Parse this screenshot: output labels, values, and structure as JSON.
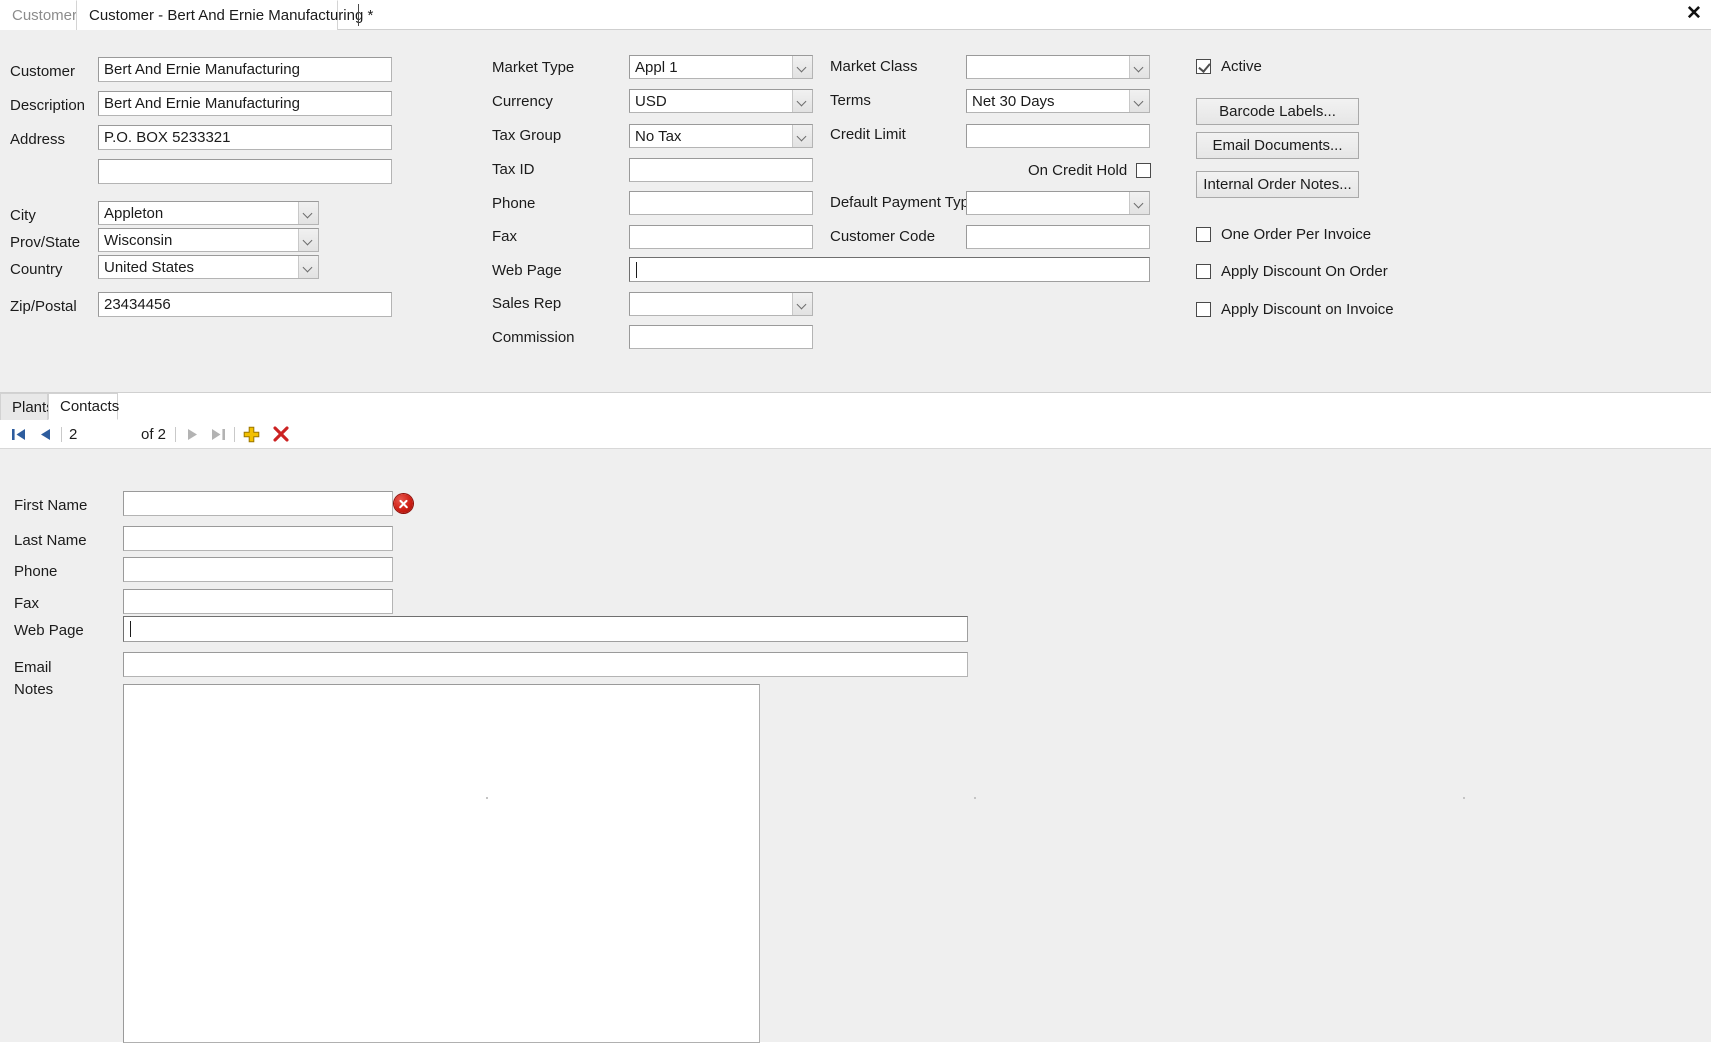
{
  "window": {
    "close_icon": "close-icon"
  },
  "tabs": [
    {
      "label": "Customers",
      "active": false
    },
    {
      "label": "Customer - Bert And Ernie Manufacturing *",
      "active": true
    }
  ],
  "customer_form": {
    "left_column": {
      "fields": [
        {
          "label": "Customer",
          "value": "Bert And Ernie Manufacturing",
          "type": "text"
        },
        {
          "label": "Description",
          "value": "Bert And Ernie Manufacturing",
          "type": "text"
        },
        {
          "label": "Address",
          "value": "P.O. BOX 5233321",
          "type": "text"
        },
        {
          "label": "",
          "value": "",
          "type": "text"
        },
        {
          "label": "City",
          "value": "Appleton",
          "type": "combo"
        },
        {
          "label": "Prov/State",
          "value": "Wisconsin",
          "type": "combo"
        },
        {
          "label": "Country",
          "value": "United States",
          "type": "combo"
        },
        {
          "label": "Zip/Postal",
          "value": "23434456",
          "type": "text"
        }
      ]
    },
    "middle_column": {
      "fields": [
        {
          "label": "Market Type",
          "value": "Appl 1",
          "type": "combo"
        },
        {
          "label": "Currency",
          "value": "USD",
          "type": "combo"
        },
        {
          "label": "Tax Group",
          "value": "No Tax",
          "type": "combo"
        },
        {
          "label": "Tax ID",
          "value": "",
          "type": "text"
        },
        {
          "label": "Phone",
          "value": "",
          "type": "text"
        },
        {
          "label": "Fax",
          "value": "",
          "type": "text"
        },
        {
          "label": "Web Page",
          "value": "",
          "type": "text-focus"
        },
        {
          "label": "Sales Rep",
          "value": "",
          "type": "combo"
        },
        {
          "label": "Commission",
          "value": "",
          "type": "text"
        }
      ]
    },
    "right_column": {
      "fields": [
        {
          "label": "Market Class",
          "value": "",
          "type": "combo"
        },
        {
          "label": "Terms",
          "value": "Net 30 Days",
          "type": "combo"
        },
        {
          "label": "Credit Limit",
          "value": "",
          "type": "text"
        },
        {
          "label": "Default Payment Type",
          "value": "",
          "type": "combo"
        },
        {
          "label": "Customer Code",
          "value": "",
          "type": "text"
        }
      ],
      "on_credit_hold": {
        "label": "On Credit Hold",
        "checked": false
      }
    },
    "actions_panel": {
      "active_checkbox": {
        "label": "Active",
        "checked": true
      },
      "buttons": [
        {
          "label": "Barcode Labels..."
        },
        {
          "label": "Email Documents..."
        },
        {
          "label": "Internal Order Notes..."
        }
      ],
      "checkboxes": [
        {
          "label": "One Order Per Invoice",
          "checked": false
        },
        {
          "label": "Apply Discount On Order",
          "checked": false
        },
        {
          "label": "Apply Discount on Invoice",
          "checked": false
        }
      ]
    }
  },
  "sub_tabs": [
    {
      "label": "Plants",
      "active": false
    },
    {
      "label": "Contacts",
      "active": true
    }
  ],
  "record_nav": {
    "first_icon": "first-record-icon",
    "prev_icon": "previous-record-icon",
    "current_record": "2",
    "total_label": "of 2",
    "next_icon": "next-record-icon",
    "last_icon": "last-record-icon",
    "add_icon": "add-record-icon",
    "delete_icon": "delete-record-icon",
    "colors": {
      "enabled": "#2e5d9e",
      "disabled": "#b3b3b3",
      "add": "#e8a317",
      "delete": "#cc2222"
    }
  },
  "contact_detail": {
    "fields": [
      {
        "label": "First Name",
        "value": "",
        "type": "text",
        "error": true
      },
      {
        "label": "Last Name",
        "value": "",
        "type": "text",
        "error": false
      },
      {
        "label": "Phone",
        "value": "",
        "type": "text",
        "error": false
      },
      {
        "label": "Fax",
        "value": "",
        "type": "text",
        "error": false
      },
      {
        "label": "Web Page",
        "value": "",
        "type": "text-focus",
        "error": false
      },
      {
        "label": "Email",
        "value": "",
        "type": "text",
        "error": false
      },
      {
        "label": "Notes",
        "value": "",
        "type": "textarea",
        "error": false
      }
    ],
    "error_icon": "error-icon"
  }
}
